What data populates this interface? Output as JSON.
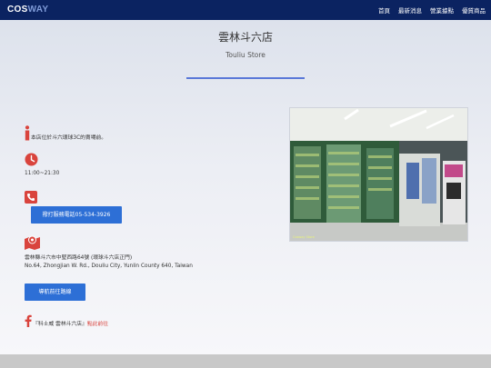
{
  "brand": {
    "logo_prefix": "COS",
    "logo_accent": "WAY"
  },
  "nav": {
    "items": [
      "首頁",
      "最新消息",
      "營業據點",
      "優質商品"
    ]
  },
  "store": {
    "title": "雲林斗六店",
    "subtitle": "Touliu Store"
  },
  "info": {
    "description": "本店位於斗六環球3C的賣場前。",
    "hours": "11:00~21:30",
    "call_button_prefix": "撥打服務電話",
    "phone": "05-534-3926",
    "address_zh": "雲林縣斗六市中堅西路64號 (環球斗六店正門)",
    "address_en": "No.64, Zhongjian W. Rd., Douliu City, Yunlin County 640, Taiwan",
    "nav_button": "導航前往路線",
    "facebook_text": "『科士威 雲林斗六店』",
    "facebook_link": "點此前往"
  },
  "photo": {
    "caption": "Cosway Store"
  },
  "colors": {
    "navbar": "#0b2361",
    "accent_blue": "#2d6fd6",
    "icon_red": "#d9443d",
    "divider": "#5a78d8"
  },
  "icons": [
    "info-icon",
    "clock-icon",
    "phone-icon",
    "map-pin-icon",
    "facebook-icon"
  ]
}
